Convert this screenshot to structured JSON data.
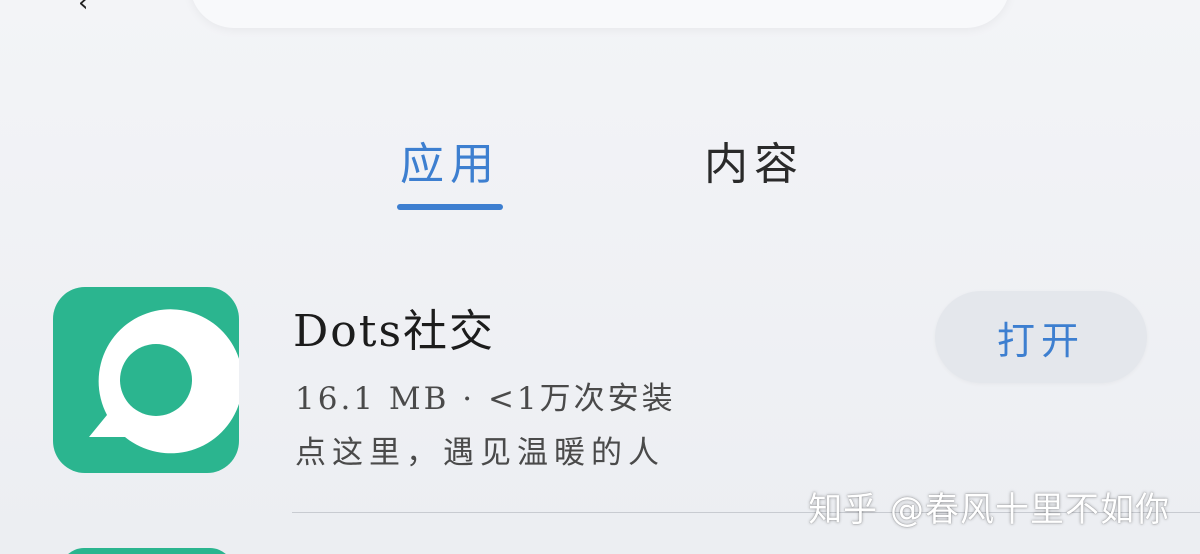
{
  "tabs": [
    {
      "label": "应用",
      "active": true
    },
    {
      "label": "内容",
      "active": false
    }
  ],
  "app": {
    "name": "Dots社交",
    "meta": "16.1 MB · <1万次安装",
    "description": "点这里，遇见温暖的人",
    "open_label": "打开",
    "icon": "dots-app-icon"
  },
  "watermark": "知乎 @春风十里不如你",
  "colors": {
    "accent": "#3d7fd0",
    "icon_green": "#2bb58f",
    "background": "#eef0f4"
  }
}
